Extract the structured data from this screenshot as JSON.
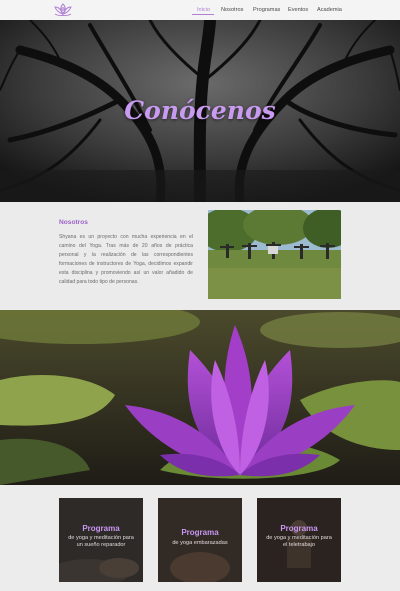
{
  "colors": {
    "accent": "#b07fd6",
    "hero_title": "#c89af0",
    "heading": "#9a63c9"
  },
  "header": {
    "logo_icon": "lotus-logo-icon",
    "nav": [
      {
        "label": "Inicio",
        "active": true
      },
      {
        "label": "Nosotros",
        "active": false
      },
      {
        "label": "Programas",
        "active": false
      },
      {
        "label": "Eventos",
        "active": false
      },
      {
        "label": "Academia",
        "active": false
      }
    ]
  },
  "hero": {
    "title": "Conócenos"
  },
  "about": {
    "heading": "Nosotros",
    "body": "Shyana es un proyecto con mucha experiencia en el camino del Yoga. Tras más de 20 años de práctica personal y la realización de las correspondientes formaciones de instructores de Yoga, decidimos expandir esta disciplina y promoviendo así un valor añadido de calidad para todo tipo de personas."
  },
  "programs": [
    {
      "title": "Programa",
      "description": "de yoga y meditación para un sueño reparador"
    },
    {
      "title": "Programa",
      "description": "de yoga embarazadas"
    },
    {
      "title": "Programa",
      "description": "de yoga y meditación para el teletrabajo"
    }
  ]
}
